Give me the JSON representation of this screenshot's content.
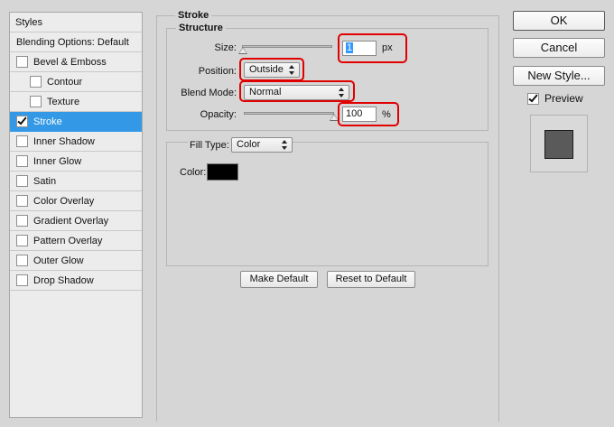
{
  "styles_panel": {
    "header": "Styles",
    "items": [
      {
        "label": "Blending Options: Default",
        "checkbox": false,
        "checked": false,
        "indent": false,
        "selected": false
      },
      {
        "label": "Bevel & Emboss",
        "checkbox": true,
        "checked": false,
        "indent": false,
        "selected": false
      },
      {
        "label": "Contour",
        "checkbox": true,
        "checked": false,
        "indent": true,
        "selected": false
      },
      {
        "label": "Texture",
        "checkbox": true,
        "checked": false,
        "indent": true,
        "selected": false
      },
      {
        "label": "Stroke",
        "checkbox": true,
        "checked": true,
        "indent": false,
        "selected": true
      },
      {
        "label": "Inner Shadow",
        "checkbox": true,
        "checked": false,
        "indent": false,
        "selected": false
      },
      {
        "label": "Inner Glow",
        "checkbox": true,
        "checked": false,
        "indent": false,
        "selected": false
      },
      {
        "label": "Satin",
        "checkbox": true,
        "checked": false,
        "indent": false,
        "selected": false
      },
      {
        "label": "Color Overlay",
        "checkbox": true,
        "checked": false,
        "indent": false,
        "selected": false
      },
      {
        "label": "Gradient Overlay",
        "checkbox": true,
        "checked": false,
        "indent": false,
        "selected": false
      },
      {
        "label": "Pattern Overlay",
        "checkbox": true,
        "checked": false,
        "indent": false,
        "selected": false
      },
      {
        "label": "Outer Glow",
        "checkbox": true,
        "checked": false,
        "indent": false,
        "selected": false
      },
      {
        "label": "Drop Shadow",
        "checkbox": true,
        "checked": false,
        "indent": false,
        "selected": false
      }
    ]
  },
  "stroke": {
    "title": "Stroke",
    "structure": {
      "title": "Structure",
      "size_label": "Size:",
      "size_value": "1",
      "size_unit": "px",
      "size_slider_level": 0.01,
      "position_label": "Position:",
      "position_value": "Outside",
      "blend_mode_label": "Blend Mode:",
      "blend_mode_value": "Normal",
      "opacity_label": "Opacity:",
      "opacity_value": "100",
      "opacity_unit": "%",
      "opacity_slider_level": 1.0
    },
    "fill": {
      "fill_type_label": "Fill Type:",
      "fill_type_value": "Color",
      "color_label": "Color:",
      "color_value": "#000000"
    },
    "make_default": "Make Default",
    "reset_default": "Reset to Default"
  },
  "actions": {
    "ok": "OK",
    "cancel": "Cancel",
    "new_style": "New Style...",
    "preview_label": "Preview",
    "preview_checked": true
  },
  "colors": {
    "selection": "#3399e6",
    "highlight": "#e00000",
    "preview_swatch": "#5a5a5a"
  }
}
